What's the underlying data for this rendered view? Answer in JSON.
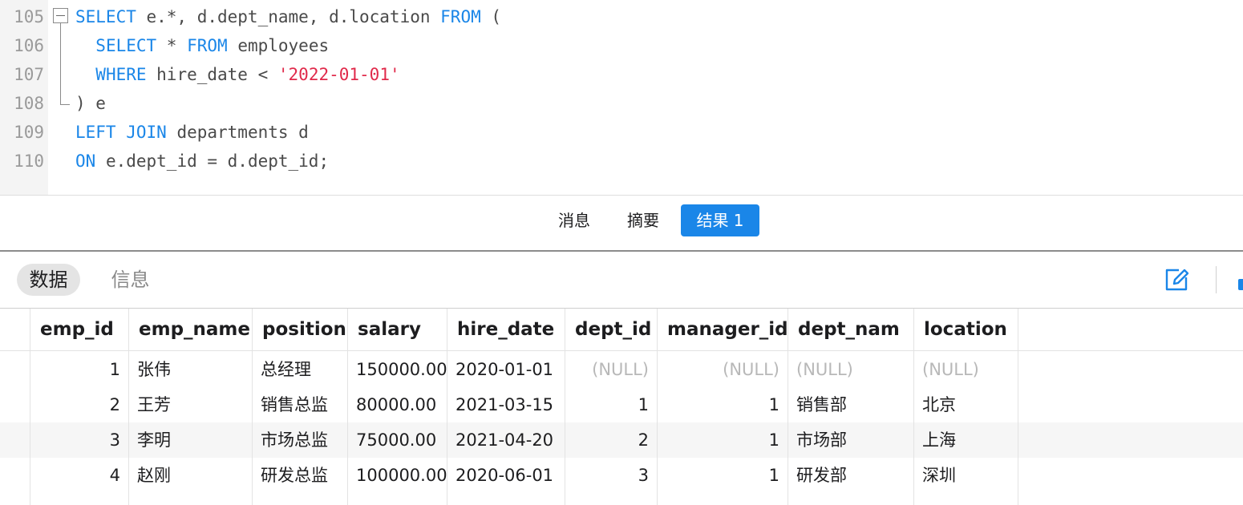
{
  "editor": {
    "lines": [
      {
        "num": "105",
        "tokens": [
          {
            "t": "SELECT",
            "c": "kw"
          },
          {
            "t": " e.*, d.dept_name, d.location ",
            "c": ""
          },
          {
            "t": "FROM",
            "c": "kw"
          },
          {
            "t": " (",
            "c": ""
          }
        ]
      },
      {
        "num": "106",
        "tokens": [
          {
            "t": "  ",
            "c": ""
          },
          {
            "t": "SELECT",
            "c": "kw"
          },
          {
            "t": " * ",
            "c": ""
          },
          {
            "t": "FROM",
            "c": "kw"
          },
          {
            "t": " employees",
            "c": ""
          }
        ]
      },
      {
        "num": "107",
        "tokens": [
          {
            "t": "  ",
            "c": ""
          },
          {
            "t": "WHERE",
            "c": "kw"
          },
          {
            "t": " hire_date < ",
            "c": ""
          },
          {
            "t": "'2022-01-01'",
            "c": "str"
          }
        ]
      },
      {
        "num": "108",
        "tokens": [
          {
            "t": ") e",
            "c": ""
          }
        ]
      },
      {
        "num": "109",
        "tokens": [
          {
            "t": "LEFT JOIN",
            "c": "kw"
          },
          {
            "t": " departments d",
            "c": ""
          }
        ]
      },
      {
        "num": "110",
        "tokens": [
          {
            "t": "ON",
            "c": "kw"
          },
          {
            "t": " e.dept_id = d.dept_id;",
            "c": ""
          }
        ]
      }
    ]
  },
  "result_tabs": {
    "messages": "消息",
    "summary": "摘要",
    "result1": "结果 1"
  },
  "subbar": {
    "data": "数据",
    "info": "信息",
    "edit_icon": "pencil-edit-icon"
  },
  "grid": {
    "columns": [
      "emp_id",
      "emp_name",
      "position",
      "salary",
      "hire_date",
      "dept_id",
      "manager_id",
      "dept_nam",
      "location"
    ],
    "rows": [
      [
        "1",
        "张伟",
        "总经理",
        "150000.00",
        "2020-01-01",
        "(NULL)",
        "(NULL)",
        "(NULL)",
        "(NULL)"
      ],
      [
        "2",
        "王芳",
        "销售总监",
        "80000.00",
        "2021-03-15",
        "1",
        "1",
        "销售部",
        "北京"
      ],
      [
        "3",
        "李明",
        "市场总监",
        "75000.00",
        "2021-04-20",
        "2",
        "1",
        "市场部",
        "上海"
      ],
      [
        "4",
        "赵刚",
        "研发总监",
        "100000.00",
        "2020-06-01",
        "3",
        "1",
        "研发部",
        "深圳"
      ]
    ]
  },
  "colors": {
    "keyword": "#1a86e8",
    "string": "#e0294a",
    "accent": "#1a86e8",
    "null_text": "#b8b8b8"
  }
}
